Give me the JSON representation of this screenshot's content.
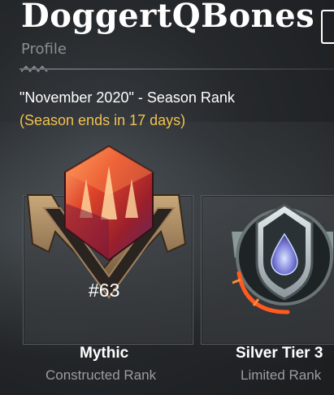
{
  "header": {
    "username": "DoggertQBones",
    "subtitle": "Profile"
  },
  "season": {
    "title": "\"November 2020\" - Season Rank",
    "ends": "(Season ends in 17 days)"
  },
  "ranks": {
    "constructed": {
      "tier": "Mythic",
      "position": "#63",
      "label": "Constructed Rank",
      "icon": "mythic-gem-icon"
    },
    "limited": {
      "tier": "Silver Tier 3",
      "label": "Limited Rank",
      "icon": "silver-shield-icon"
    }
  },
  "colors": {
    "accent": "#f2c14e",
    "mythic_gem": "#e0452a",
    "limited_flame": "#ff5a1f"
  }
}
